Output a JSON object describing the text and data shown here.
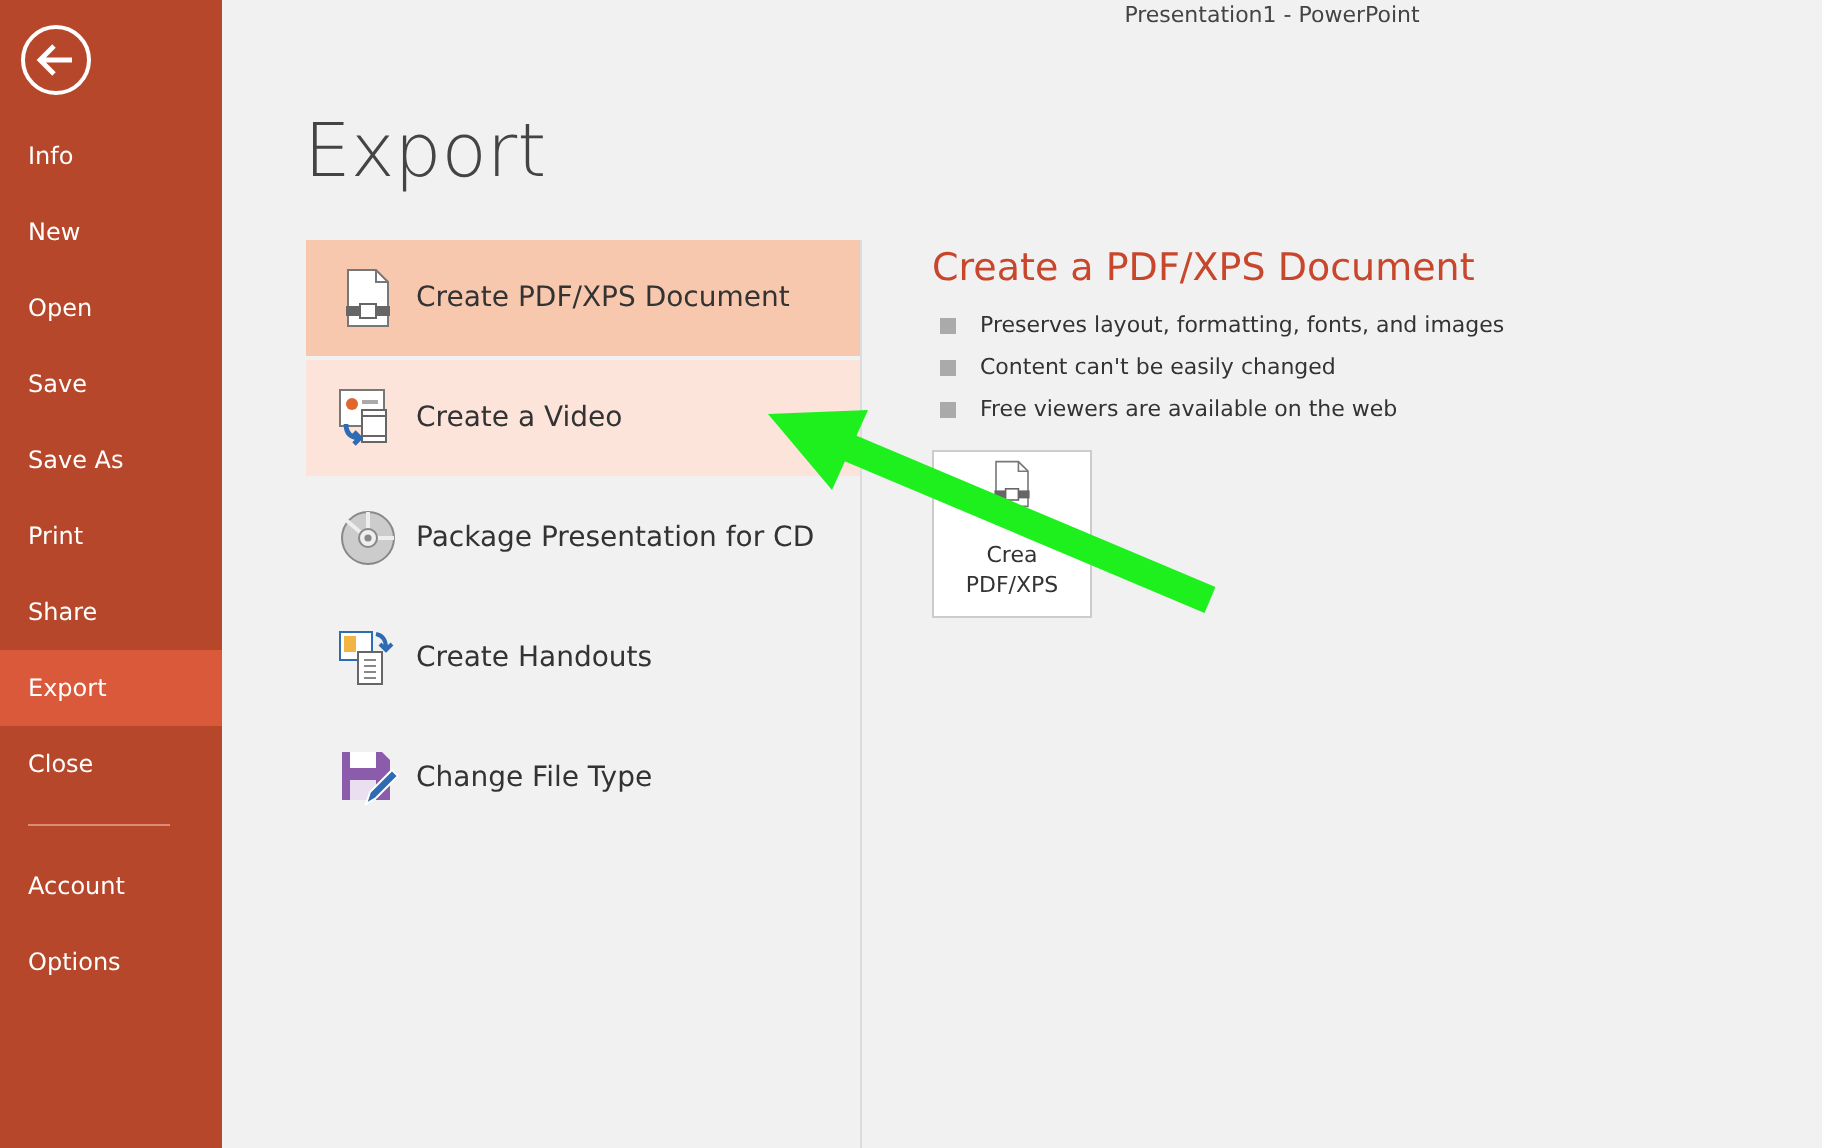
{
  "window": {
    "title": "Presentation1 - PowerPoint"
  },
  "sidebar": {
    "items": [
      {
        "label": "Info",
        "selected": false
      },
      {
        "label": "New",
        "selected": false
      },
      {
        "label": "Open",
        "selected": false
      },
      {
        "label": "Save",
        "selected": false
      },
      {
        "label": "Save As",
        "selected": false
      },
      {
        "label": "Print",
        "selected": false
      },
      {
        "label": "Share",
        "selected": false
      },
      {
        "label": "Export",
        "selected": true
      },
      {
        "label": "Close",
        "selected": false
      }
    ],
    "bottom_items": [
      {
        "label": "Account",
        "selected": false
      },
      {
        "label": "Options",
        "selected": false
      }
    ]
  },
  "page_title": "Export",
  "options": [
    {
      "label": "Create PDF/XPS Document",
      "kind": "pdf",
      "selected": true,
      "hovered": false
    },
    {
      "label": "Create a Video",
      "kind": "video",
      "selected": false,
      "hovered": true
    },
    {
      "label": "Package Presentation for CD",
      "kind": "cd",
      "selected": false,
      "hovered": false
    },
    {
      "label": "Create Handouts",
      "kind": "handouts",
      "selected": false,
      "hovered": false
    },
    {
      "label": "Change File Type",
      "kind": "filetype",
      "selected": false,
      "hovered": false
    }
  ],
  "detail": {
    "title": "Create a PDF/XPS Document",
    "bullets": [
      "Preserves layout, formatting, fonts, and images",
      "Content can't be easily changed",
      "Free viewers are available on the web"
    ],
    "button": {
      "lines": [
        "Crea",
        "PDF/XPS"
      ]
    }
  },
  "annotation": {
    "kind": "arrow"
  }
}
